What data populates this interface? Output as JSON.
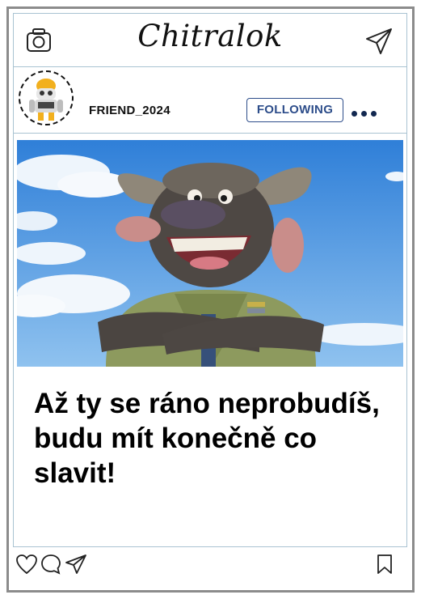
{
  "app": {
    "title": "Chitralok"
  },
  "icons": {
    "camera": "camera-icon",
    "send": "paper-plane-icon",
    "more": "more-dots-icon",
    "like": "heart-icon",
    "comment": "comment-bubble-icon",
    "share": "paper-plane-icon",
    "save": "bookmark-icon"
  },
  "post": {
    "username": "FRIEND_2024",
    "follow_label": "FOLLOWING",
    "caption": "Až ty se ráno neprobudíš, budu mít konečně co slavit!"
  },
  "colors": {
    "follow_text": "#2d4d8a",
    "divider": "#a9c3d2",
    "frame": "#8c8c8c"
  }
}
